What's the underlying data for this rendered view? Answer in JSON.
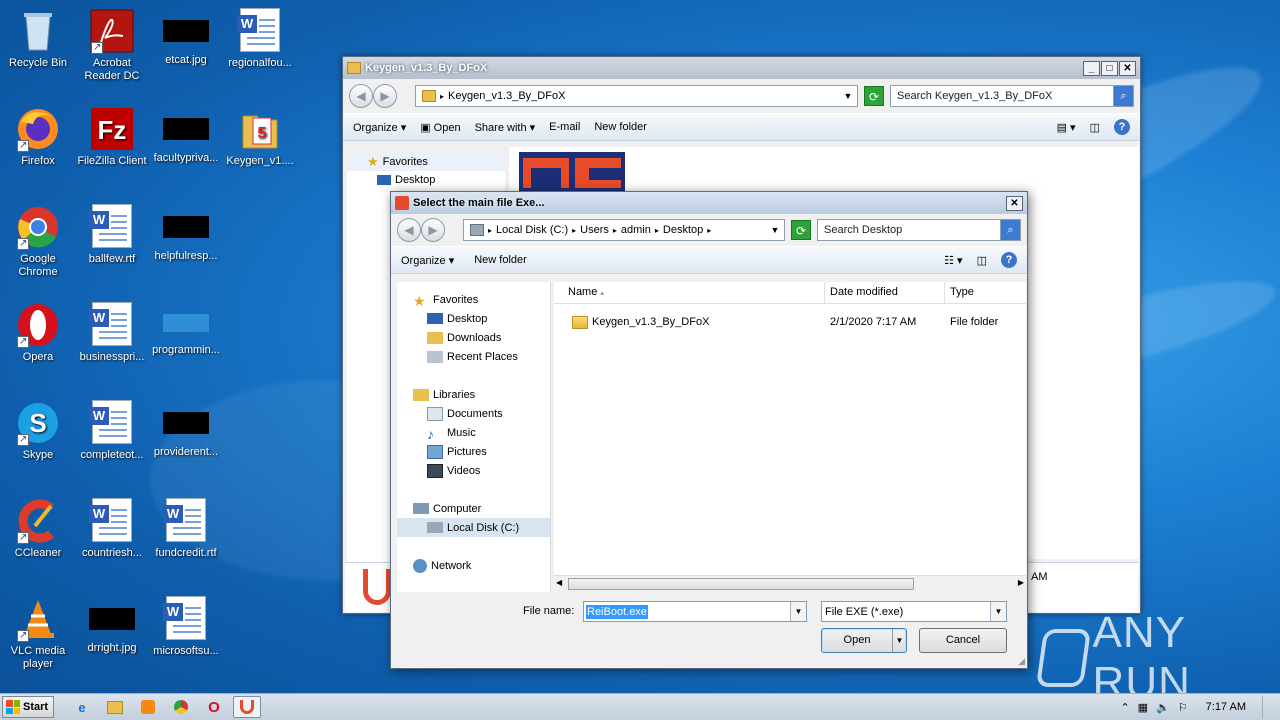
{
  "desktop": {
    "icons": [
      {
        "label": "Recycle Bin"
      },
      {
        "label": "Acrobat Reader DC"
      },
      {
        "label": "etcat.jpg"
      },
      {
        "label": "regionalfou..."
      },
      {
        "label": "Firefox"
      },
      {
        "label": "FileZilla Client"
      },
      {
        "label": "facultypriva..."
      },
      {
        "label": "Keygen_v1...."
      },
      {
        "label": "Google Chrome"
      },
      {
        "label": "ballfew.rtf"
      },
      {
        "label": "helpfulresp..."
      },
      {
        "label": "Opera"
      },
      {
        "label": "businesspri..."
      },
      {
        "label": "programmin..."
      },
      {
        "label": "Skype"
      },
      {
        "label": "completeot..."
      },
      {
        "label": "providerent..."
      },
      {
        "label": "CCleaner"
      },
      {
        "label": "countriesh..."
      },
      {
        "label": "fundcredit.rtf"
      },
      {
        "label": "VLC media player"
      },
      {
        "label": "drright.jpg"
      },
      {
        "label": "microsoftsu..."
      }
    ]
  },
  "explorer": {
    "title": "Keygen_v1.3_By_DFoX",
    "address": "Keygen_v1.3_By_DFoX",
    "search_placeholder": "Search Keygen_v1.3_By_DFoX",
    "toolbar": {
      "organize": "Organize",
      "open": "Open",
      "share": "Share with",
      "email": "E-mail",
      "new_folder": "New folder"
    },
    "nav": {
      "favorites": "Favorites",
      "desktop": "Desktop"
    },
    "partial_text": "AM"
  },
  "dialog": {
    "title": "Select the main file Exe...",
    "breadcrumb": [
      "Local Disk (C:)",
      "Users",
      "admin",
      "Desktop"
    ],
    "search_placeholder": "Search Desktop",
    "toolbar": {
      "organize": "Organize",
      "new_folder": "New folder"
    },
    "nav": {
      "favorites": "Favorites",
      "desktop": "Desktop",
      "downloads": "Downloads",
      "recent": "Recent Places",
      "libraries": "Libraries",
      "documents": "Documents",
      "music": "Music",
      "pictures": "Pictures",
      "videos": "Videos",
      "computer": "Computer",
      "local_disk": "Local Disk (C:)",
      "network": "Network"
    },
    "columns": {
      "name": "Name",
      "date": "Date modified",
      "type": "Type"
    },
    "files": [
      {
        "name": "Keygen_v1.3_By_DFoX",
        "date": "2/1/2020 7:17 AM",
        "type": "File folder"
      }
    ],
    "file_name_label": "File name:",
    "file_name_value": "ReiBoot.exe",
    "file_type": "File EXE (*.exe)",
    "open_label": "Open",
    "cancel_label": "Cancel"
  },
  "taskbar": {
    "start_label": "Start",
    "clock": "7:17 AM"
  },
  "watermark": "ANY RUN"
}
